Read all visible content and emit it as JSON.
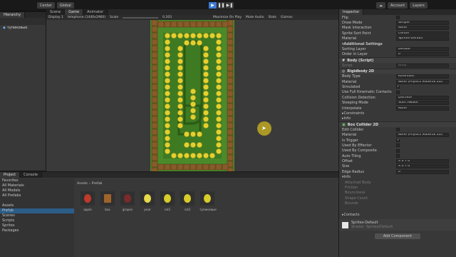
{
  "toolbar": {
    "account_btn": "Account",
    "layers_btn": "Layers",
    "layout_btn": "Layout",
    "center_btn": "Center",
    "global_btn": "Global"
  },
  "scene_tabs": [
    "Scene",
    "Game",
    "Animator"
  ],
  "game_bar": {
    "display": "Display 1",
    "resolution": "telephone (1440x2960)",
    "scale_label": "Scale",
    "scale_value": "0.203",
    "buttons": [
      "Maximize On Play",
      "Mute Audio",
      "Stats",
      "Gizmos"
    ]
  },
  "hierarchy": {
    "tab": "Hierarchy",
    "item": "тупиковые"
  },
  "project": {
    "tabs": [
      "Project",
      "Console"
    ],
    "breadcrumb": [
      "Assets",
      "Prefab"
    ],
    "left_items": [
      "Favorites",
      "All Materials",
      "All Models",
      "All Prefabs",
      "",
      "Assets",
      "Prefab",
      "Scenes",
      "Scripts",
      "Sprites",
      "Packages"
    ],
    "assets": [
      {
        "name": "apple",
        "color": "#c0392b"
      },
      {
        "name": "box",
        "color": "#a0632a"
      },
      {
        "name": "grapes",
        "color": "#7b2a2a"
      },
      {
        "name": "pear",
        "color": "#e8d84a"
      },
      {
        "name": "rot1",
        "color": "#d8cc2a"
      },
      {
        "name": "rot2",
        "color": "#d8cc2a"
      },
      {
        "name": "тупиковые",
        "color": "#d8cc2a"
      }
    ]
  },
  "inspector": {
    "tab": "Inspector",
    "rows": [
      {
        "label": "Flip",
        "value": ""
      },
      {
        "label": "Draw Mode",
        "value": "Simple"
      },
      {
        "label": "Mask Interaction",
        "value": "None"
      },
      {
        "label": "Sprite Sort Point",
        "value": "Center"
      },
      {
        "label": "Material",
        "value": "Sprites-Default"
      }
    ],
    "additional": "Additional Settings",
    "add_rows": [
      {
        "label": "Sorting Layer",
        "value": "Default"
      },
      {
        "label": "Order in Layer",
        "value": "0"
      }
    ],
    "body_script": "Body (Script)",
    "script_label": "Script",
    "script_value": "Body",
    "rigidbody": "Rigidbody 2D",
    "rb_rows": [
      {
        "label": "Body Type",
        "value": "Kinematic"
      },
      {
        "label": "Material",
        "value": "None (Physics Material 2D)"
      },
      {
        "label": "Simulated",
        "value": "✓"
      },
      {
        "label": "Use Full Kinematic Contacts",
        "value": ""
      },
      {
        "label": "Collision Detection",
        "value": "Discrete"
      },
      {
        "label": "Sleeping Mode",
        "value": "Start Awake"
      },
      {
        "label": "Interpolate",
        "value": "None"
      }
    ],
    "constraints": "Constraints",
    "info": "Info",
    "box_collider": "Box Collider 2D",
    "bc_rows": [
      {
        "label": "Edit Collider",
        "value": ""
      },
      {
        "label": "Material",
        "value": "None (Physics Material 2D)"
      },
      {
        "label": "Is Trigger",
        "value": "✓"
      },
      {
        "label": "Used By Effector",
        "value": ""
      },
      {
        "label": "Used By Composite",
        "value": ""
      },
      {
        "label": "Auto Tiling",
        "value": ""
      },
      {
        "label": "Offset",
        "value": "X 0        Y 0"
      },
      {
        "label": "Size",
        "value": "X 0        Y 0"
      },
      {
        "label": "Edge Radius",
        "value": "0"
      }
    ],
    "info2": "Info",
    "info_rows": [
      "Attached Body",
      "Friction",
      "Bounciness",
      "Shape Count",
      "Bounds"
    ],
    "contacts": "Contacts",
    "mat_name": "Sprites-Default",
    "shader_label": "Shader",
    "shader_value": "Sprites/Default",
    "add_component": "Add Component"
  }
}
